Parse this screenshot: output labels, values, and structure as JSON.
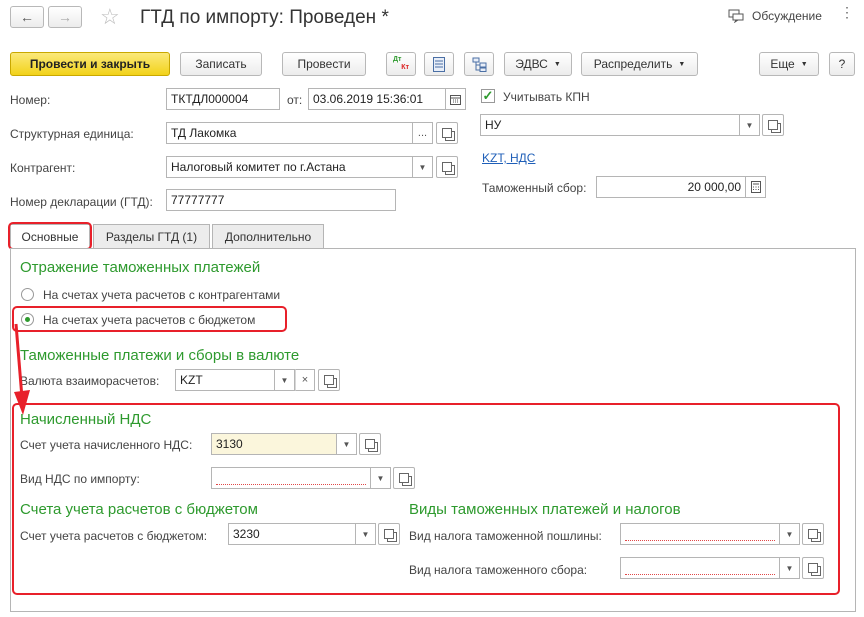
{
  "header": {
    "title": "ГТД по импорту: Проведен *",
    "discussion_label": "Обсуждение"
  },
  "toolbar": {
    "post_close": "Провести и закрыть",
    "save": "Записать",
    "post": "Провести",
    "dt_kt_top": "Дт",
    "dt_kt_bottom": "Кт",
    "edvs": "ЭДВС",
    "distribute": "Распределить",
    "more": "Еще",
    "help": "?"
  },
  "form": {
    "number_label": "Номер:",
    "number_value": "ТКТДЛ000004",
    "from_label": "от:",
    "date_value": "03.06.2019 15:36:01",
    "kpn_label": "Учитывать КПН",
    "kpn_checked": true,
    "struct_label": "Структурная единица:",
    "struct_value": "ТД Лакомка",
    "nu_value": "НУ",
    "contractor_label": "Контрагент:",
    "contractor_value": "Налоговый комитет по г.Астана",
    "currency_link": "KZT, НДС",
    "decl_label": "Номер декларации (ГТД):",
    "decl_value": "77777777",
    "customs_fee_label": "Таможенный сбор:",
    "customs_fee_value": "20 000,00"
  },
  "tabs": [
    {
      "label": "Основные"
    },
    {
      "label": "Разделы ГТД (1)"
    },
    {
      "label": "Дополнительно"
    }
  ],
  "main": {
    "payments_title": "Отражение таможенных платежей",
    "radio1": "На счетах учета расчетов с контрагентами",
    "radio2": "На счетах учета расчетов с бюджетом",
    "radio_selected": 2,
    "currency_title": "Таможенные платежи и сборы в валюте",
    "settlement_currency_label": "Валюта взаиморасчетов:",
    "settlement_currency_value": "KZT",
    "vat_title": "Начисленный НДС",
    "vat_account_label": "Счет учета начисленного НДС:",
    "vat_account_value": "3130",
    "vat_type_label": "Вид НДС по импорту:",
    "vat_type_value": "",
    "budget_title": "Счета учета расчетов с бюджетом",
    "budget_account_label": "Счет учета расчетов с бюджетом:",
    "budget_account_value": "3230",
    "types_title": "Виды таможенных платежей и налогов",
    "duty_tax_label": "Вид налога таможенной пошлины:",
    "duty_tax_value": "",
    "fee_tax_label": "Вид налога таможенного сбора:",
    "fee_tax_value": ""
  },
  "colors": {
    "primary_button": "#f2d21a",
    "section_title": "#2e9a2e",
    "highlight": "#e8202a",
    "link": "#1f5fb8"
  }
}
